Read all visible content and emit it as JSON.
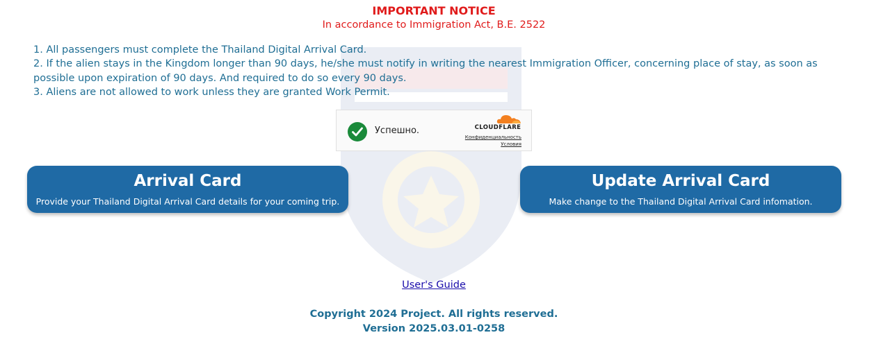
{
  "notice": {
    "title": "IMPORTANT NOTICE",
    "subtitle": "In accordance to Immigration Act, B.E. 2522"
  },
  "rules": [
    "1. All passengers must complete the Thailand Digital Arrival Card.",
    "2. If the alien stays in the Kingdom longer than 90 days, he/she must notify in writing the nearest Immigration Officer, concerning place of stay, as soon as possible upon expiration of 90 days. And required to do so every 90 days.",
    "3. Aliens are not allowed to work unless they are granted Work Permit."
  ],
  "captcha": {
    "status": "Успешно.",
    "brand": "CLOUDFLARE",
    "privacy_link": "Конфиденциальность",
    "terms_link": "Условия"
  },
  "buttons": {
    "arrival": {
      "title": "Arrival Card",
      "description": "Provide your Thailand Digital Arrival Card details for your coming trip."
    },
    "update": {
      "title": "Update Arrival Card",
      "description": "Make change to the Thailand Digital Arrival Card infomation."
    }
  },
  "footer": {
    "guide_link": "User's Guide",
    "copyright": "Copyright 2024 Project. All rights reserved.",
    "version": "Version 2025.03.01-0258"
  },
  "icons": {
    "watermark": "police-emblem-icon",
    "captcha_success": "checkmark-icon",
    "captcha_logo": "cloudflare-cloud-icon"
  },
  "colors": {
    "notice_red": "#e01b1b",
    "text_blue": "#1f6e94",
    "button_blue": "#1f6aa5",
    "link_blue": "#1a0dab",
    "success_green": "#1a8a3a",
    "cloudflare_orange": "#f38020"
  }
}
